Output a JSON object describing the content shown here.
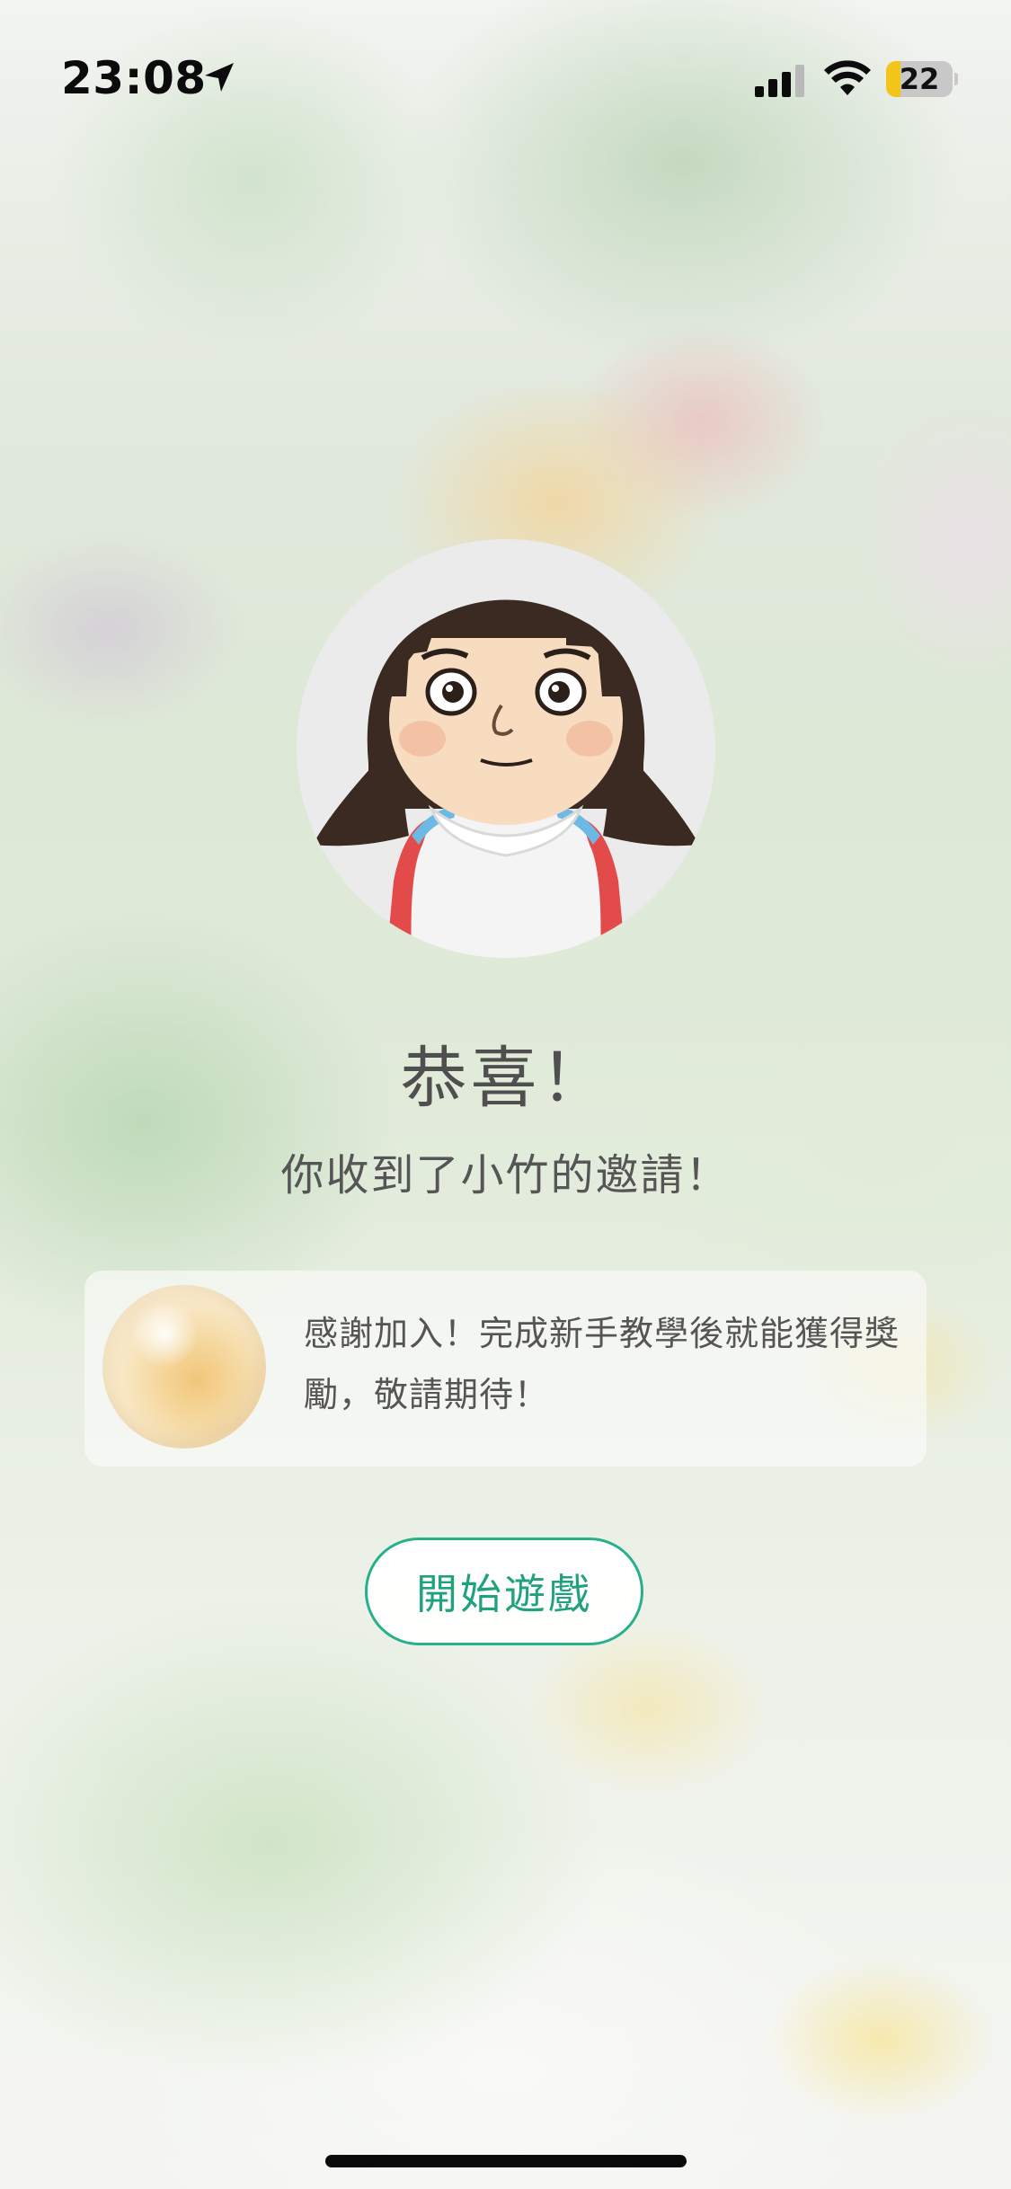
{
  "status_bar": {
    "time": "23:08",
    "battery_level": "22",
    "battery_fraction": 0.22,
    "battery_color": "#f3c51b",
    "icons": [
      "location-arrow-icon",
      "cellular-signal-icon",
      "wifi-icon",
      "battery-icon"
    ]
  },
  "invite": {
    "title": "恭喜！",
    "subtitle": "你收到了小竹的邀請！"
  },
  "reward": {
    "icon": "reward-orb-icon",
    "text": "感謝加入！完成新手教學後就能獲得獎勵，敬請期待！"
  },
  "actions": {
    "start_button_label": "開始遊戲"
  },
  "colors": {
    "accent": "#28b08a",
    "text": "#555555"
  }
}
